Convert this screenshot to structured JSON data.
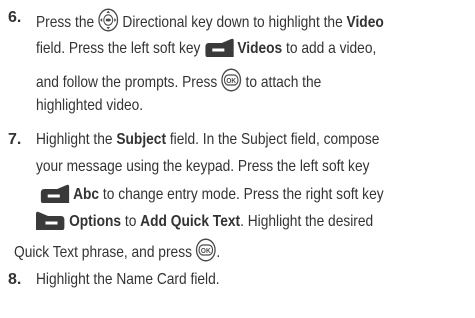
{
  "steps": [
    {
      "number": "6.",
      "lines": [
        {
          "a": "Press the",
          "b": "Directional key down to highlight the",
          "c": "Video"
        },
        {
          "a": "field. Press the left soft key",
          "b": "Videos",
          "c": "to add a video,"
        },
        {
          "a": "and follow the prompts. Press",
          "b": "to attach the"
        },
        {
          "a": "highlighted video."
        }
      ]
    },
    {
      "number": "7.",
      "lines": [
        {
          "a": "Highlight the",
          "b": "Subject",
          "c": "field. In the Subject field, compose"
        },
        {
          "a": "your message using the keypad. Press the left soft key"
        },
        {
          "b": "Abc",
          "c": "to change entry mode. Press the right soft key"
        },
        {
          "b": "Options",
          "c": "to",
          "d": "Add Quick Text",
          "e": ". Highlight the desired"
        },
        {
          "a": "Quick Text phrase, and press",
          "b": "."
        }
      ]
    },
    {
      "number": "8.",
      "lines": [
        {
          "a": "Highlight the Name Card field."
        }
      ]
    }
  ],
  "icons": {
    "directional_key": "directional-key-icon",
    "left_soft_key": "left-soft-key-icon",
    "right_soft_key": "right-soft-key-icon",
    "ok_key": "ok-key-icon",
    "ok_label": "OK"
  }
}
